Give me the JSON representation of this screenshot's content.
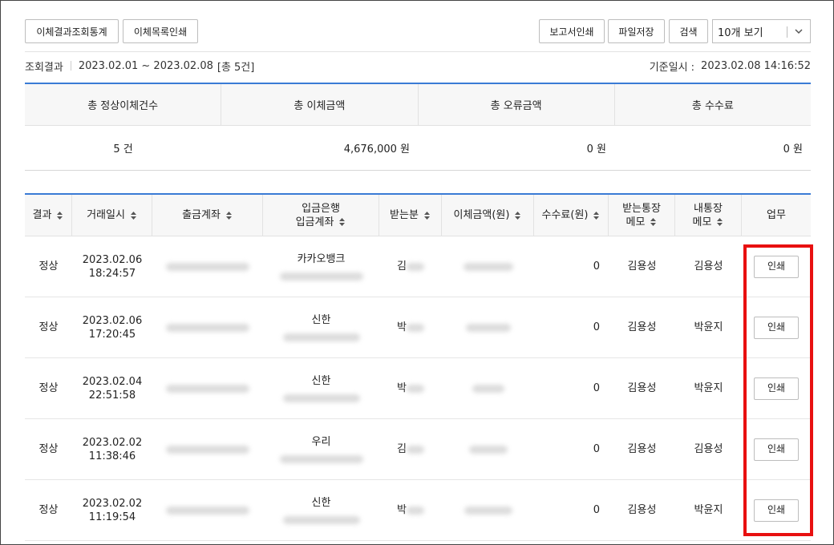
{
  "toolbar": {
    "transfer_stats_label": "이체결과조회통계",
    "list_print_label": "이체목록인쇄",
    "report_print_label": "보고서인쇄",
    "file_save_label": "파일저장",
    "search_label": "검색",
    "view_count_value": "10개 보기",
    "view_count_icon": "chevron-down-icon"
  },
  "info": {
    "label": "조회결과",
    "period": "2023.02.01 ~ 2023.02.08",
    "total": "[총 5건]",
    "base_label": "기준일시 :",
    "base_datetime": "2023.02.08 14:16:52"
  },
  "summary": {
    "headers": [
      "총 정상이체건수",
      "총 이체금액",
      "총 오류금액",
      "총 수수료"
    ],
    "values": [
      "5 건",
      "4,676,000 원",
      "0 원",
      "0 원"
    ]
  },
  "table": {
    "headers": {
      "result": "결과",
      "datetime": "거래일시",
      "from_account": "출금계좌",
      "bank_line1": "입금은행",
      "bank_line2": "입금계좌",
      "recipient": "받는분",
      "amount": "이체금액(원)",
      "fee": "수수료(원)",
      "recv_memo_line1": "받는통장",
      "recv_memo_line2": "메모",
      "my_memo_line1": "내통장",
      "my_memo_line2": "메모",
      "task": "업무"
    },
    "rows": [
      {
        "result": "정상",
        "date": "2023.02.06",
        "time": "18:24:57",
        "bank": "카카오뱅크",
        "recipient": "김",
        "fee": "0",
        "recv_memo": "김용성",
        "my_memo": "김용성",
        "action": "인쇄"
      },
      {
        "result": "정상",
        "date": "2023.02.06",
        "time": "17:20:45",
        "bank": "신한",
        "recipient": "박",
        "fee": "0",
        "recv_memo": "김용성",
        "my_memo": "박윤지",
        "action": "인쇄"
      },
      {
        "result": "정상",
        "date": "2023.02.04",
        "time": "22:51:58",
        "bank": "신한",
        "recipient": "박",
        "fee": "0",
        "recv_memo": "김용성",
        "my_memo": "박윤지",
        "action": "인쇄"
      },
      {
        "result": "정상",
        "date": "2023.02.02",
        "time": "11:38:46",
        "bank": "우리",
        "recipient": "김",
        "fee": "0",
        "recv_memo": "김용성",
        "my_memo": "김용성",
        "action": "인쇄"
      },
      {
        "result": "정상",
        "date": "2023.02.02",
        "time": "11:19:54",
        "bank": "신한",
        "recipient": "박",
        "fee": "0",
        "recv_memo": "김용성",
        "my_memo": "박윤지",
        "action": "인쇄"
      }
    ]
  },
  "colors": {
    "accent_border": "#3a7bd5",
    "highlight": "#e81010"
  }
}
